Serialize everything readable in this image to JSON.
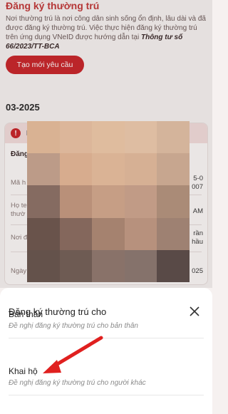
{
  "header": {
    "title": "Đăng ký thường trú"
  },
  "intro": {
    "text": "Nơi thường trú là nơi công dân sinh sống ổn định, lâu dài và đã được đăng ký thường trú. Việc thực hiện đăng ký thường trú trên ứng dụng VNeID được hướng dẫn tại ",
    "circular": "Thông tư số 66/2023/TT-BCA"
  },
  "create_button": "Tạo mới yêu cầu",
  "month_label": "03-2025",
  "record_card": {
    "header_partial": "K",
    "section_label": "Đăng",
    "rows": [
      {
        "label": "Mã h",
        "value": "5-0\n007"
      },
      {
        "label": "Họ te\nthườ",
        "value": "AM"
      },
      {
        "label": "Nơi đ",
        "value": "rần\nhầu"
      },
      {
        "label": "Ngày",
        "value": "025"
      }
    ]
  },
  "mosaic_colors": [
    "#e9bf9e",
    "#ecc4a5",
    "#efcaaa",
    "#eecbae",
    "#e3c2a6",
    "#c9a792",
    "#e6b998",
    "#eac0a0",
    "#e5bd9f",
    "#d5b29a",
    "#8e7268",
    "#c69b82",
    "#d4aa8f",
    "#cfa690",
    "#b6957f",
    "#6f5850",
    "#8c6e62",
    "#b08b77",
    "#c49c86",
    "#a98a7a",
    "#6a5750",
    "#756158",
    "#927a70",
    "#8e7a72",
    "#5e4f4b"
  ],
  "bottom_sheet": {
    "title": "Đăng ký thường trú cho",
    "options": [
      {
        "title": "Bản thân",
        "subtitle": "Đề nghị đăng ký thường trú cho bản thân"
      },
      {
        "title": "Khai hộ",
        "subtitle": "Đề nghị đăng ký thường trú cho người khác"
      }
    ]
  },
  "colors": {
    "brand_red": "#c8262b",
    "arrow_red": "#e0201f"
  },
  "icons": {
    "warning": "warning-icon",
    "close": "close-icon",
    "annotation": "red-arrow-annotation"
  }
}
